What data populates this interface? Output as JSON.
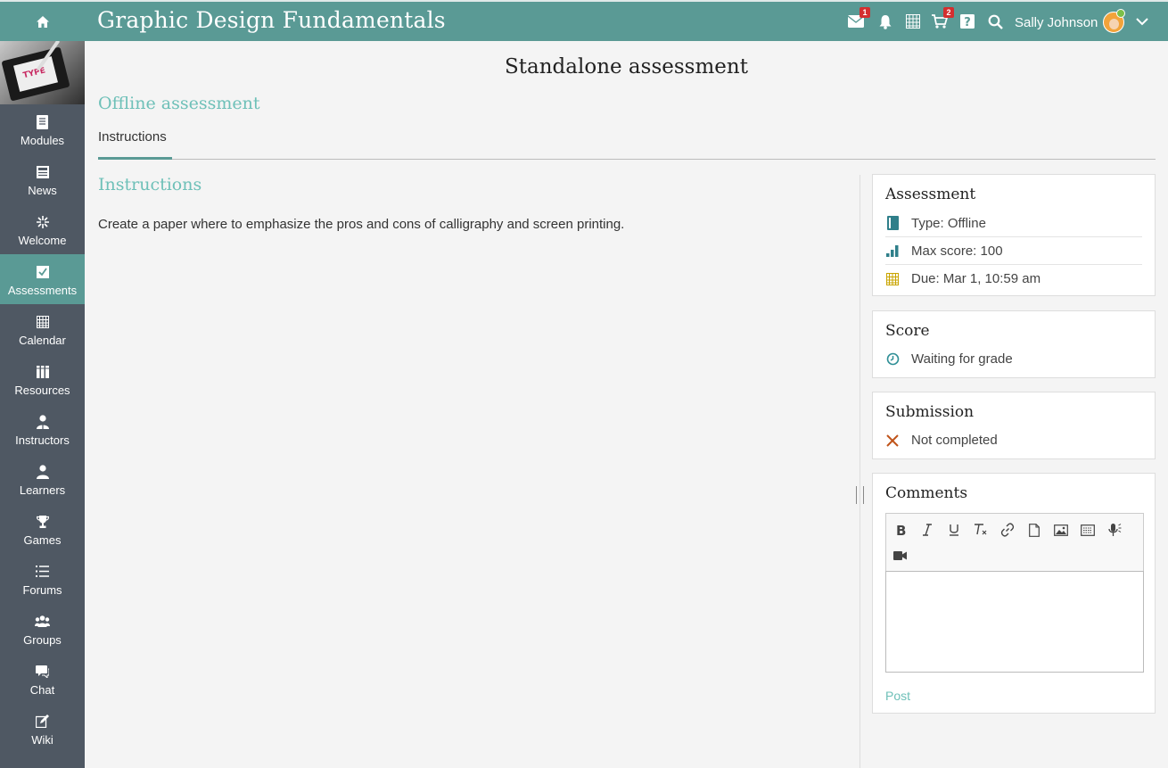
{
  "header": {
    "title": "Graphic Design Fundamentals",
    "messages_badge": "1",
    "cart_badge": "2",
    "user_name": "Sally Johnson"
  },
  "sidebar": {
    "items": [
      {
        "label": "Modules",
        "icon": "book-icon"
      },
      {
        "label": "News",
        "icon": "newspaper-icon"
      },
      {
        "label": "Welcome",
        "icon": "sparkle-icon"
      },
      {
        "label": "Assessments",
        "icon": "checkbox-icon",
        "active": true
      },
      {
        "label": "Calendar",
        "icon": "calendar-icon"
      },
      {
        "label": "Resources",
        "icon": "books-icon"
      },
      {
        "label": "Instructors",
        "icon": "instructor-icon"
      },
      {
        "label": "Learners",
        "icon": "person-icon"
      },
      {
        "label": "Games",
        "icon": "trophy-icon"
      },
      {
        "label": "Forums",
        "icon": "list-icon"
      },
      {
        "label": "Groups",
        "icon": "group-icon"
      },
      {
        "label": "Chat",
        "icon": "chat-icon"
      },
      {
        "label": "Wiki",
        "icon": "edit-icon"
      }
    ]
  },
  "main": {
    "page_title": "Standalone assessment",
    "subtitle": "Offline assessment",
    "tab_label": "Instructions",
    "section_title": "Instructions",
    "instructions_text": "Create a paper where to emphasize the pros and cons of calligraphy and screen printing."
  },
  "assessment_card": {
    "title": "Assessment",
    "type": "Type: Offline",
    "max_score": "Max score: 100",
    "due": "Due: Mar 1, 10:59 am"
  },
  "score_card": {
    "title": "Score",
    "status": "Waiting for grade"
  },
  "submission_card": {
    "title": "Submission",
    "status": "Not completed"
  },
  "comments_card": {
    "title": "Comments",
    "post_label": "Post"
  },
  "colors": {
    "accent": "#5a9a95",
    "accent_light": "#6ec0b8",
    "sidebar": "#4f5863",
    "badge": "#d32f2f"
  }
}
